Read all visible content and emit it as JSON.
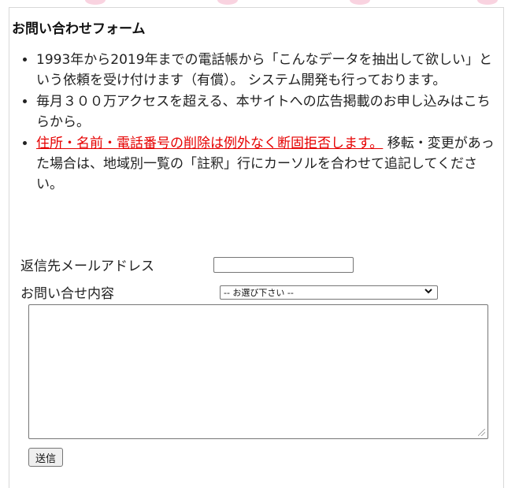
{
  "form": {
    "title": "お問い合わせフォーム",
    "notes": [
      "1993年から2019年までの電話帳から「こんなデータを抽出して欲しい」という依頼を受け付けます（有償）。 システム開発も行っております。",
      "毎月３００万アクセスを超える、本サイトへの広告掲載のお申し込みはこちらから。"
    ],
    "notice_link": "住所・名前・電話番号の削除は例外なく断固拒否します。",
    "notice_text": " 移転・変更があった場合は、地域別一覧の「註釈」行にカーソルを合わせて追記してください。",
    "email_label": "返信先メールアドレス",
    "email_value": "",
    "inquiry_label": "お問い合せ内容",
    "inquiry_selected": "-- お選び下さい --",
    "message_value": "",
    "submit_label": "送信"
  },
  "colors": {
    "warning_link": "#e60000",
    "decoration_pink": "#f9d3e0"
  },
  "icons": {
    "select_arrow": "chevron-down-icon",
    "resize": "resize-grip-icon"
  }
}
